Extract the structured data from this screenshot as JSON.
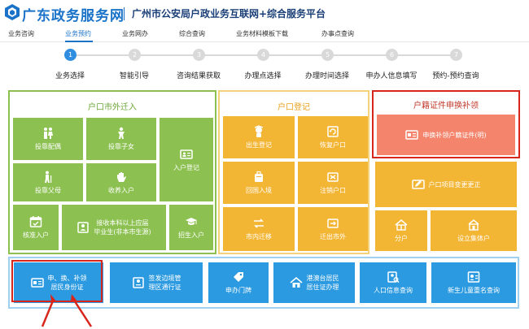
{
  "header": {
    "site_name": "广东政务服务网",
    "sub_title": "广州市公安局户政业务互联网+综合服务平台"
  },
  "nav": {
    "items": [
      {
        "label": "业务咨询"
      },
      {
        "label": "业务预约"
      },
      {
        "label": "业务网办"
      },
      {
        "label": "综合查询"
      },
      {
        "label": "业务材料模板下载"
      },
      {
        "label": "办事点查询"
      }
    ]
  },
  "steps": [
    {
      "num": "1",
      "label": "业务选择"
    },
    {
      "num": "2",
      "label": "智能引导"
    },
    {
      "num": "3",
      "label": "咨询结果获取"
    },
    {
      "num": "4",
      "label": "办理点选择"
    },
    {
      "num": "5",
      "label": "办理时间选择"
    },
    {
      "num": "6",
      "label": "申办人信息填写"
    },
    {
      "num": "7",
      "label": "预约-预约查询"
    }
  ],
  "panels": {
    "outer_in": {
      "title": "户口市外迁入",
      "tiles": {
        "spouse": "投靠配偶",
        "children": "投靠子女",
        "parents": "投靠父母",
        "adopt": "收养入户",
        "register": "入户登记",
        "approve": "核准入户",
        "graduate_1": "接收本科以上应届",
        "graduate_2": "毕业生(非本市生源)",
        "recruit": "招生入户"
      }
    },
    "register": {
      "title": "户口登记",
      "tiles": {
        "birth": "出生登记",
        "restore": "恢复户口",
        "return": "回国入境",
        "cancel": "注销户口",
        "move_in_city": "市内迁移",
        "move_out": "迁出市外",
        "split": "分户",
        "collective": "设立集体户",
        "change": "户口项目变更更正"
      }
    },
    "household_cert": {
      "title": "户籍证件申换补领",
      "tiles": {
        "cert": "申换补领户籍证件(明)"
      }
    },
    "bottom": {
      "tiles": {
        "id_1": "申、换、补领",
        "id_2": "居民身份证",
        "border_1": "签发边境管",
        "border_2": "理区通行证",
        "door": "申办门牌",
        "hk_1": "港澳台居民",
        "hk_2": "居住证办理",
        "info": "人口信息查询",
        "name": "新生儿童重名查询"
      }
    }
  },
  "colors": {
    "green": "#8cc152",
    "amber": "#f3b534",
    "salmon": "#f4856c",
    "blue": "#2b9ae0",
    "highlight_red": "#d9261c",
    "brand_blue": "#1a73c8"
  }
}
